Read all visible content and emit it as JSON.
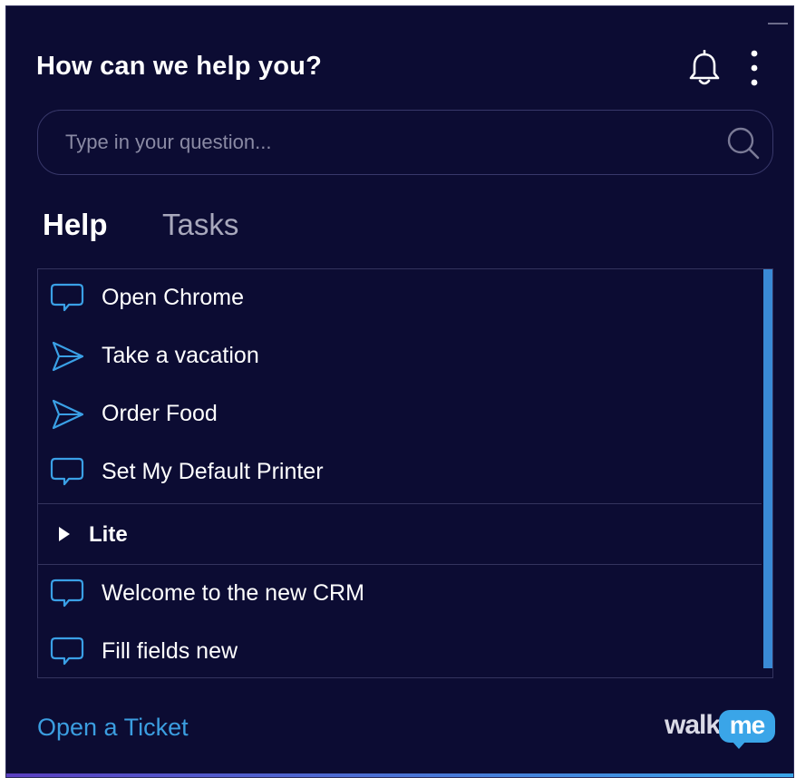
{
  "header": {
    "title": "How can we help you?"
  },
  "search": {
    "placeholder": "Type in your question..."
  },
  "tabs": [
    {
      "label": "Help",
      "active": true
    },
    {
      "label": "Tasks",
      "active": false
    }
  ],
  "items": [
    {
      "label": "Open Chrome",
      "icon": "chat-bubble-icon"
    },
    {
      "label": "Take a vacation",
      "icon": "paper-plane-icon"
    },
    {
      "label": "Order Food",
      "icon": "paper-plane-icon"
    },
    {
      "label": "Set My Default Printer",
      "icon": "chat-bubble-icon"
    }
  ],
  "group": {
    "label": "Lite",
    "items": [
      {
        "label": "Welcome to the new CRM",
        "icon": "chat-bubble-icon"
      },
      {
        "label": "Fill fields new",
        "icon": "chat-bubble-icon"
      }
    ]
  },
  "footer": {
    "ticket_label": "Open a Ticket",
    "brand_word": "walk",
    "brand_bubble": "me"
  },
  "colors": {
    "background": "#0c0c33",
    "accent": "#3b9ee0",
    "icon_stroke": "#3aa0e6"
  }
}
